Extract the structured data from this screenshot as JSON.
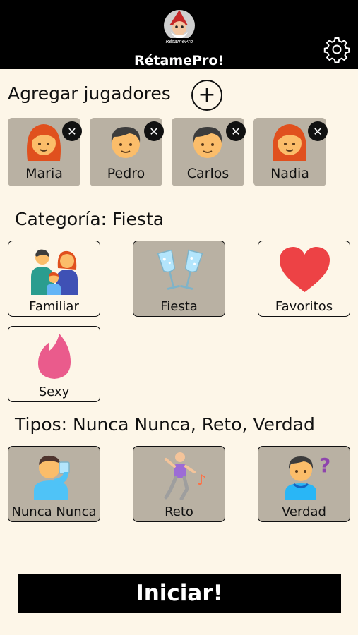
{
  "app": {
    "logo_text": "RétamePro",
    "title": "RétamePro!"
  },
  "icons": {
    "settings": "gear-icon",
    "add": "plus-icon",
    "remove": "close-icon"
  },
  "players": {
    "heading": "Agregar jugadores",
    "add_label": "+",
    "remove_label": "✕",
    "items": [
      {
        "name": "Maria",
        "avatar": "woman-red-hair-icon"
      },
      {
        "name": "Pedro",
        "avatar": "man-icon"
      },
      {
        "name": "Carlos",
        "avatar": "man-icon"
      },
      {
        "name": "Nadia",
        "avatar": "woman-red-hair-icon"
      }
    ]
  },
  "categories": {
    "heading": "Categoría:  Fiesta",
    "selected": "Fiesta",
    "items": [
      {
        "label": "Familiar",
        "icon": "family-icon"
      },
      {
        "label": "Fiesta",
        "icon": "clinking-glasses-icon"
      },
      {
        "label": "Favoritos",
        "icon": "heart-icon"
      },
      {
        "label": "Sexy",
        "icon": "flame-icon"
      }
    ]
  },
  "types": {
    "heading": "Tipos:  Nunca Nunca, Reto, Verdad",
    "items": [
      {
        "label": "Nunca Nunca",
        "icon": "person-drinking-icon",
        "selected": true
      },
      {
        "label": "Reto",
        "icon": "dancing-icon",
        "selected": true
      },
      {
        "label": "Verdad",
        "icon": "person-question-icon",
        "selected": true
      }
    ]
  },
  "start_label": "Iniciar!",
  "colors": {
    "bar": "#000000",
    "background": "#fdf6e8",
    "selected_tile": "#b9b1a3",
    "heart": "#ed4245",
    "flame": "#ea5b8c"
  }
}
